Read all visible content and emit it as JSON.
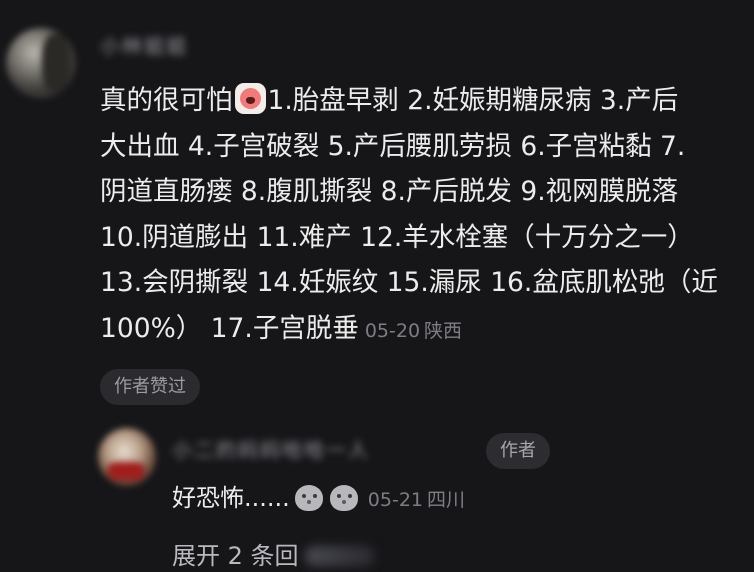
{
  "comment": {
    "username": "小林姐姐",
    "lines": [
      "真的很可怕",
      "1.胎盘早剥 2.妊娠期糖尿病 3.产后",
      "大出血 4.子宫破裂 5.产后腰肌劳损 6.子宫粘黏 7.",
      "阴道直肠瘘 8.腹肌撕裂 8.产后脱发 9.视网膜脱落",
      "10.阴道膨出 11.难产 12.羊水栓塞（十万分之一）",
      "13.会阴撕裂 14.妊娠纹 15.漏尿 16.盆底肌松弛（近",
      "100%） 17.子宫脱垂"
    ],
    "date": "05-20",
    "location": "陕西",
    "liked_badge": "作者赞过"
  },
  "reply": {
    "username": "小二的妈妈哈哈一人",
    "author_badge": "作者",
    "text": "好恐怖......",
    "date": "05-21",
    "location": "四川"
  },
  "expand": {
    "label": "展开 2 条回"
  },
  "icons": {
    "main_emoji": "crying-face-emoji",
    "reply_emoji": "scared-ghost-emoji"
  }
}
